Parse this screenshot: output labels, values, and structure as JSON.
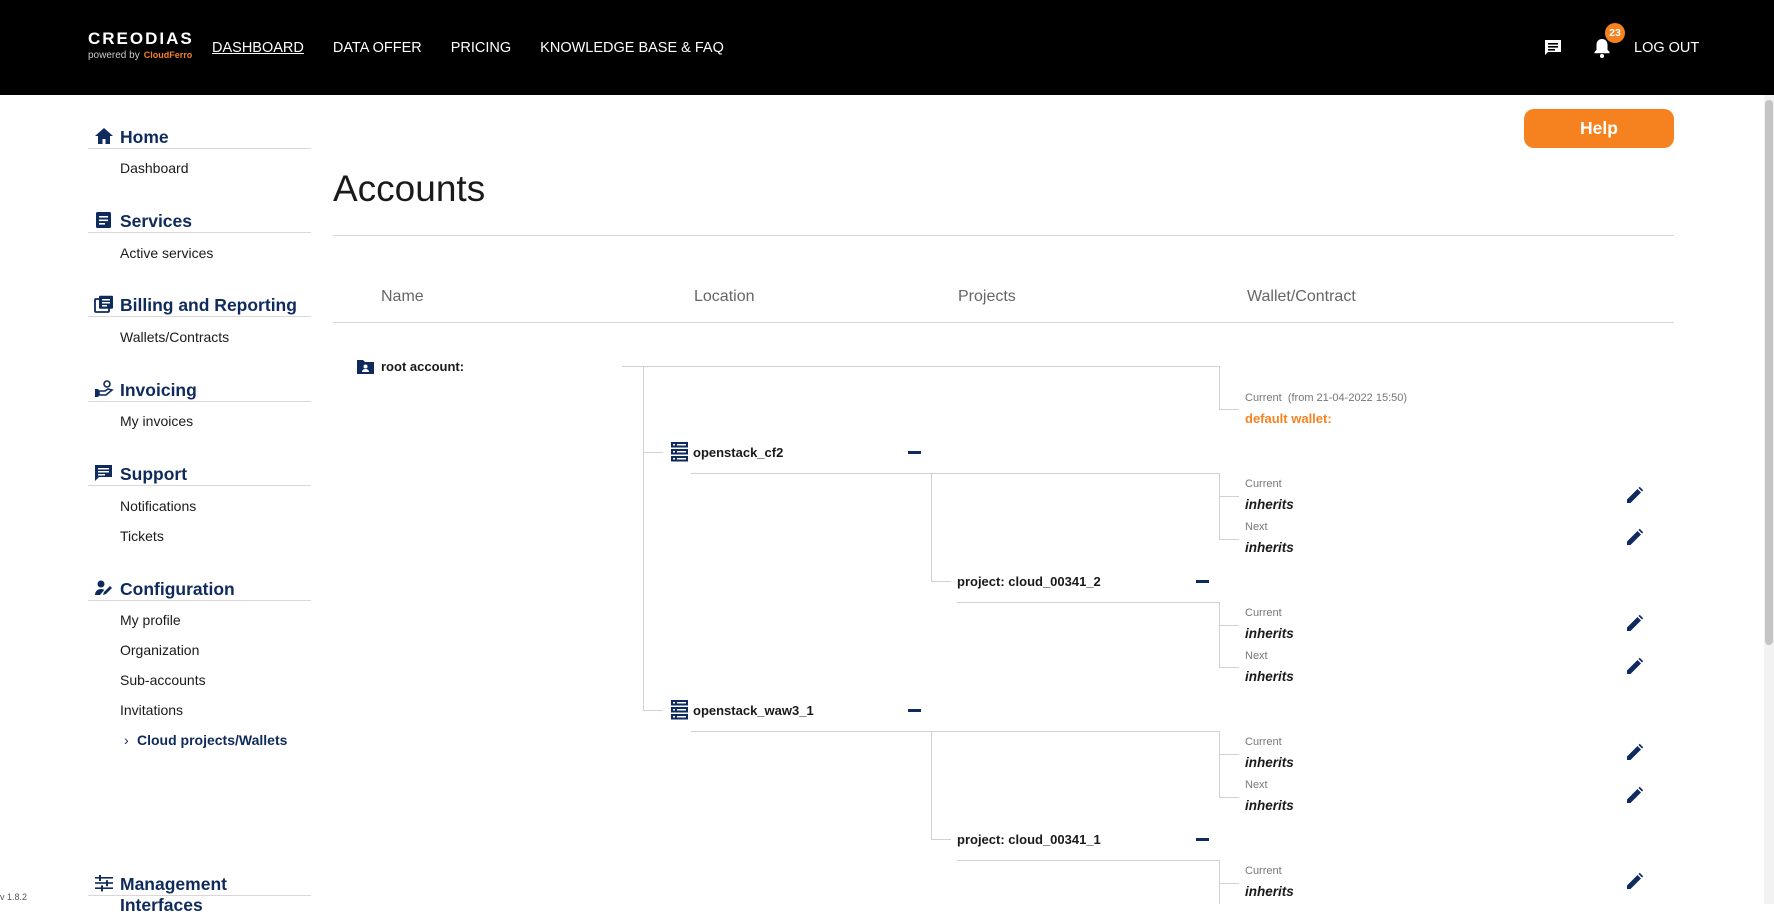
{
  "header": {
    "logo_brand": "CREODIAS",
    "logo_powered": "powered by",
    "logo_partner": "CloudFerro",
    "nav": [
      "DASHBOARD",
      "DATA OFFER",
      "PRICING",
      "KNOWLEDGE BASE & FAQ"
    ],
    "notification_count": "23",
    "logout": "LOG OUT",
    "icons": [
      "message-icon",
      "bell-icon"
    ]
  },
  "sidebar": {
    "sections": [
      {
        "title": "Home",
        "icon": "home-icon",
        "items": [
          "Dashboard"
        ]
      },
      {
        "title": "Services",
        "icon": "services-icon",
        "items": [
          "Active services"
        ]
      },
      {
        "title": "Billing and Reporting",
        "icon": "billing-icon",
        "items": [
          "Wallets/Contracts"
        ]
      },
      {
        "title": "Invoicing",
        "icon": "invoicing-icon",
        "items": [
          "My invoices"
        ]
      },
      {
        "title": "Support",
        "icon": "support-icon",
        "items": [
          "Notifications",
          "Tickets"
        ]
      },
      {
        "title": "Configuration",
        "icon": "configuration-icon",
        "items": [
          "My profile",
          "Organization",
          "Sub-accounts",
          "Invitations",
          "Cloud projects/Wallets"
        ]
      },
      {
        "title": "Management Interfaces",
        "icon": "sliders-icon",
        "items": []
      }
    ],
    "active_item": "Cloud projects/Wallets"
  },
  "main": {
    "help": "Help",
    "title": "Accounts",
    "columns": [
      "Name",
      "Location",
      "Projects",
      "Wallet/Contract"
    ],
    "root": {
      "label": "root account:",
      "current_label": "Current",
      "current_since": "(from 21-04-2022 15:50)",
      "wallet": "default wallet:"
    },
    "locations": [
      {
        "name": "openstack_cf2",
        "current_label": "Current",
        "current": "inherits",
        "next_label": "Next",
        "next": "inherits",
        "project": {
          "name": "project: cloud_00341_2",
          "current_label": "Current",
          "current": "inherits",
          "next_label": "Next",
          "next": "inherits"
        }
      },
      {
        "name": "openstack_waw3_1",
        "current_label": "Current",
        "current": "inherits",
        "next_label": "Next",
        "next": "inherits",
        "project": {
          "name": "project: cloud_00341_1",
          "current_label": "Current",
          "current": "inherits"
        }
      }
    ]
  },
  "version": "v 1.8.2",
  "colors": {
    "accent": "#f5821f",
    "navy": "#0f2a5c",
    "topbar": "#000000"
  }
}
